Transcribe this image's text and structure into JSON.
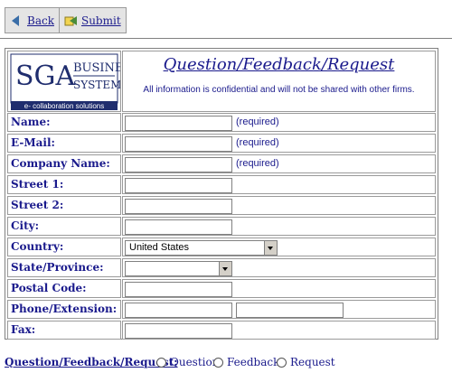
{
  "toolbar": {
    "back_label": "Back",
    "submit_label": "Submit"
  },
  "header": {
    "logo": {
      "top": "SGA BUSINESS",
      "middle": "SYSTEMS",
      "tagline": "e- collaboration solutions"
    },
    "title": "Question/Feedback/Request",
    "subtitle": "All information is confidential and will not be shared with other firms."
  },
  "fields": {
    "name": {
      "label": "Name:",
      "note": "(required)",
      "value": ""
    },
    "email": {
      "label": "E-Mail:",
      "note": "(required)",
      "value": ""
    },
    "company": {
      "label": "Company Name:",
      "note": "(required)",
      "value": ""
    },
    "street1": {
      "label": "Street 1:",
      "value": ""
    },
    "street2": {
      "label": "Street 2:",
      "value": ""
    },
    "city": {
      "label": "City:",
      "value": ""
    },
    "country": {
      "label": "Country:",
      "selected": "United States"
    },
    "state": {
      "label": "State/Province:",
      "selected": ""
    },
    "postal": {
      "label": "Postal Code:",
      "value": ""
    },
    "phone": {
      "label": "Phone/Extension:",
      "value": "",
      "ext_value": ""
    },
    "fax": {
      "label": "Fax:",
      "value": ""
    }
  },
  "footer": {
    "label": "Question/Feedback/Request:",
    "options": [
      "Question",
      "Feedback",
      "Request"
    ]
  },
  "colors": {
    "text": "#1a1a8c",
    "logo_bg": "#1f2d6e"
  }
}
